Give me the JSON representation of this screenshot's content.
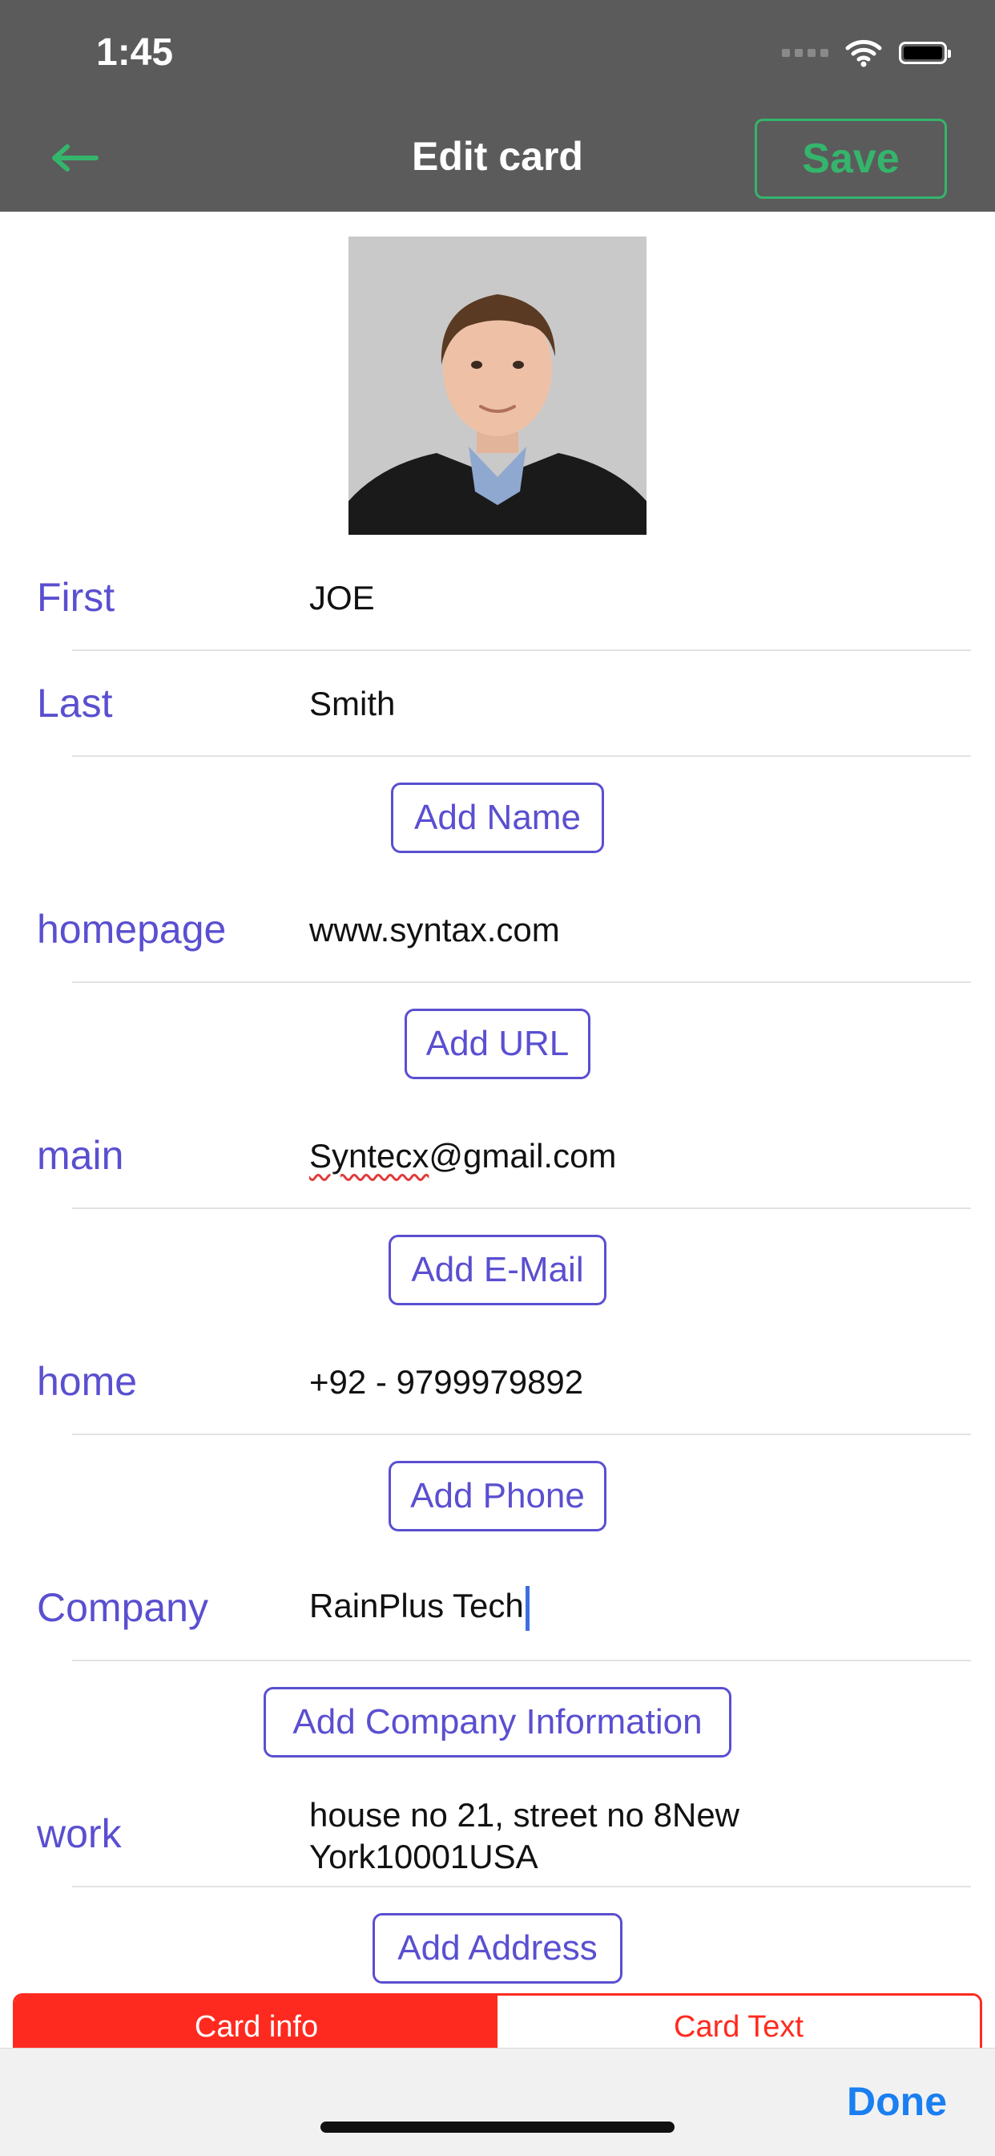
{
  "status_bar": {
    "time": "1:45"
  },
  "nav": {
    "back_icon": "arrow-left-icon",
    "title": "Edit card",
    "save_label": "Save"
  },
  "fields": [
    {
      "label": "First",
      "value": "JOE"
    },
    {
      "label": "Last",
      "value": "Smith"
    },
    {
      "label": "homepage",
      "value": "www.syntax.com"
    },
    {
      "label": "main",
      "value_misspelled": "Syntecx",
      "value_rest": "@gmail.com"
    },
    {
      "label": "home",
      "value": "+92 - 9799979892"
    },
    {
      "label": "Company",
      "value": "RainPlus Tech"
    },
    {
      "label": "work",
      "value_line1": "house no 21, street no 8New",
      "value_line2": "York10001USA"
    }
  ],
  "buttons": {
    "add_name": "Add Name",
    "add_url": "Add URL",
    "add_email": "Add E-Mail",
    "add_phone": "Add Phone",
    "add_company": "Add Company Information",
    "add_address": "Add Address"
  },
  "segments": [
    {
      "label": "Card info",
      "active": true
    },
    {
      "label": "Card Text",
      "active": false
    }
  ],
  "keyboard_toolbar": {
    "done_label": "Done"
  },
  "colors": {
    "accent_label": "#5a4fd0",
    "save_green": "#35b56c",
    "segment_red": "#ff2a1f",
    "done_blue": "#1a7ff0",
    "header_gray": "#5b5b5b"
  }
}
